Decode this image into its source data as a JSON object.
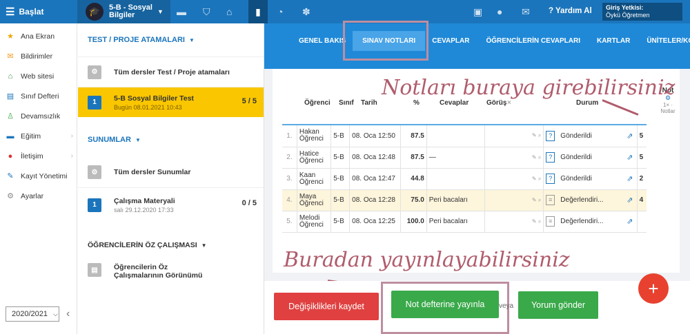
{
  "topbar": {
    "start": "Başlat",
    "class_name": "5-B - Sosyal Bilgiler",
    "help": "Yardım Al",
    "login_label": "Giriş Yetkisi:",
    "login_user": "Öykü Öğretmen"
  },
  "sidebar": {
    "items": [
      {
        "label": "Ana Ekran",
        "icon": "star-icon"
      },
      {
        "label": "Bildirimler",
        "icon": "mail-icon"
      },
      {
        "label": "Web sitesi",
        "icon": "home-icon"
      },
      {
        "label": "Sınıf Defteri",
        "icon": "notebook-icon"
      },
      {
        "label": "Devamsızlık",
        "icon": "user-icon"
      },
      {
        "label": "Eğitim",
        "icon": "briefcase-icon"
      },
      {
        "label": "İletişim",
        "icon": "chat-icon"
      },
      {
        "label": "Kayıt Yönetimi",
        "icon": "pen-icon"
      },
      {
        "label": "Ayarlar",
        "icon": "gear-icon"
      }
    ],
    "year": "2020/2021"
  },
  "assign": {
    "tests_header": "TEST / PROJE ATAMALARI",
    "all_tests": "Tüm dersler Test / Proje atamaları",
    "test_title": "5-B Sosyal Bilgiler Test",
    "test_date": "Bugün 08.01.2021 10:43",
    "test_count": "5 / 5",
    "pres_header": "SUNUMLAR",
    "all_pres": "Tüm dersler Sunumlar",
    "pres_title": "Çalışma Materyali",
    "pres_date": "salı 29.12.2020 17:33",
    "pres_count": "0 / 5",
    "self_header": "ÖĞRENCİLERİN ÖZ ÇALIŞMASI",
    "self_item": "Öğrencilerin Öz Çalışmalarının Görünümü"
  },
  "tabs": [
    "GENEL BAKIŞ",
    "SINAV NOTLARI",
    "CEVAPLAR",
    "ÖĞRENCİLERİN CEVAPLARI",
    "KARTLAR",
    "ÜNİTELER/KONUL"
  ],
  "table": {
    "headers": {
      "student": "Öğrenci",
      "class": "Sınıf",
      "date": "Tarih",
      "pct": "%",
      "answers": "Cevaplar",
      "view": "Görüş",
      "status": "Durum",
      "grade": "Not",
      "grade_sub": "1× · Notlar"
    },
    "rows": [
      {
        "n": "1.",
        "first": "Hakan",
        "last": "Öğrenci",
        "cls": "5-B",
        "date": "08. Oca 12:50",
        "pct": "87.5",
        "ans": "",
        "status": "Gönderildi",
        "grade": "5"
      },
      {
        "n": "2.",
        "first": "Hatice",
        "last": "Öğrenci",
        "cls": "5-B",
        "date": "08. Oca 12:48",
        "pct": "87.5",
        "ans": "—",
        "status": "Gönderildi",
        "grade": "5"
      },
      {
        "n": "3.",
        "first": "Kaan",
        "last": "Öğrenci",
        "cls": "5-B",
        "date": "08. Oca 12:47",
        "pct": "44.8",
        "ans": "",
        "status": "Gönderildi",
        "grade": "2"
      },
      {
        "n": "4.",
        "first": "Maya",
        "last": "Öğrenci",
        "cls": "5-B",
        "date": "08. Oca 12:28",
        "pct": "75.0",
        "ans": "Peri bacaları",
        "status": "Değerlendiri...",
        "grade": "4"
      },
      {
        "n": "5.",
        "first": "Melodi",
        "last": "Öğrenci",
        "cls": "5-B",
        "date": "08. Oca 12:25",
        "pct": "100.0",
        "ans": "Peri bacaları",
        "status": "Değerlendiri...",
        "grade": ""
      }
    ]
  },
  "annotations": {
    "top": "Notları buraya girebilirsiniz",
    "bottom": "Buradan yayınlayabilirsiniz"
  },
  "buttons": {
    "save": "Değişiklikleri kaydet",
    "publish": "Not defterine yayınla",
    "or": "veya",
    "comment": "Yorum gönder",
    "fab": "+"
  },
  "colors": {
    "topbar": "#1b75bc",
    "selected": "#f9c600",
    "annotation": "#b05c6c",
    "green": "#3aa94a",
    "red": "#e04040"
  }
}
